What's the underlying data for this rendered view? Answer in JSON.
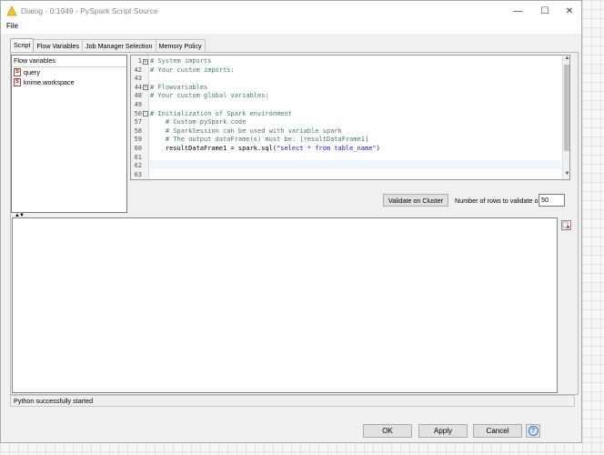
{
  "window": {
    "title": "Dialog - 0:1949 - PySpark Script Source",
    "minimize_icon": "minimize-icon",
    "maximize_icon": "maximize-icon",
    "close_icon": "close-icon"
  },
  "menu": {
    "file": "File"
  },
  "tabs": [
    {
      "label": "Script",
      "active": true
    },
    {
      "label": "Flow Variables",
      "active": false
    },
    {
      "label": "Job Manager Selection",
      "active": false
    },
    {
      "label": "Memory Policy",
      "active": false
    }
  ],
  "flow_variables": {
    "header": "Flow variables",
    "items": [
      {
        "icon": "S",
        "name": "query"
      },
      {
        "icon": "S",
        "name": "knime.workspace"
      }
    ]
  },
  "editor": {
    "lines": [
      {
        "num": "1",
        "fold": "+",
        "text": "# System imports",
        "comment": true
      },
      {
        "num": "42",
        "fold": "",
        "text": "# Your custom imports:",
        "comment": true
      },
      {
        "num": "43",
        "fold": "",
        "text": "",
        "comment": false
      },
      {
        "num": "44",
        "fold": "+",
        "text": "# Flowvariables",
        "comment": true
      },
      {
        "num": "48",
        "fold": "",
        "text": "# Your custom global variables:",
        "comment": true
      },
      {
        "num": "49",
        "fold": "",
        "text": "",
        "comment": false
      },
      {
        "num": "50",
        "fold": "-",
        "text": "# Initialization of Spark environment",
        "comment": true
      },
      {
        "num": "57",
        "fold": "",
        "text": "    # Custom pySpark code",
        "comment": true
      },
      {
        "num": "58",
        "fold": "",
        "text": "    # SparkSession can be used with variable spark",
        "comment": true
      },
      {
        "num": "59",
        "fold": "",
        "text": "    # The output dataFrame(s) must be: [resultDataFrame1]",
        "comment": true
      },
      {
        "num": "60",
        "fold": "",
        "text": "    resultDataFrame1 = spark.sql(",
        "string": "\"select * from table_name\"",
        "tail": ")",
        "comment": false
      },
      {
        "num": "61",
        "fold": "",
        "text": "",
        "comment": false
      },
      {
        "num": "62",
        "fold": "",
        "text": "",
        "comment": false
      },
      {
        "num": "63",
        "fold": "",
        "text": "",
        "comment": false
      }
    ]
  },
  "validate": {
    "button": "Validate on Cluster",
    "rows_label": "Number of rows to validate on",
    "rows_value": "50"
  },
  "status": "Python successfully started",
  "buttons": {
    "ok": "OK",
    "apply": "Apply",
    "cancel": "Cancel",
    "help_icon": "help-icon"
  }
}
